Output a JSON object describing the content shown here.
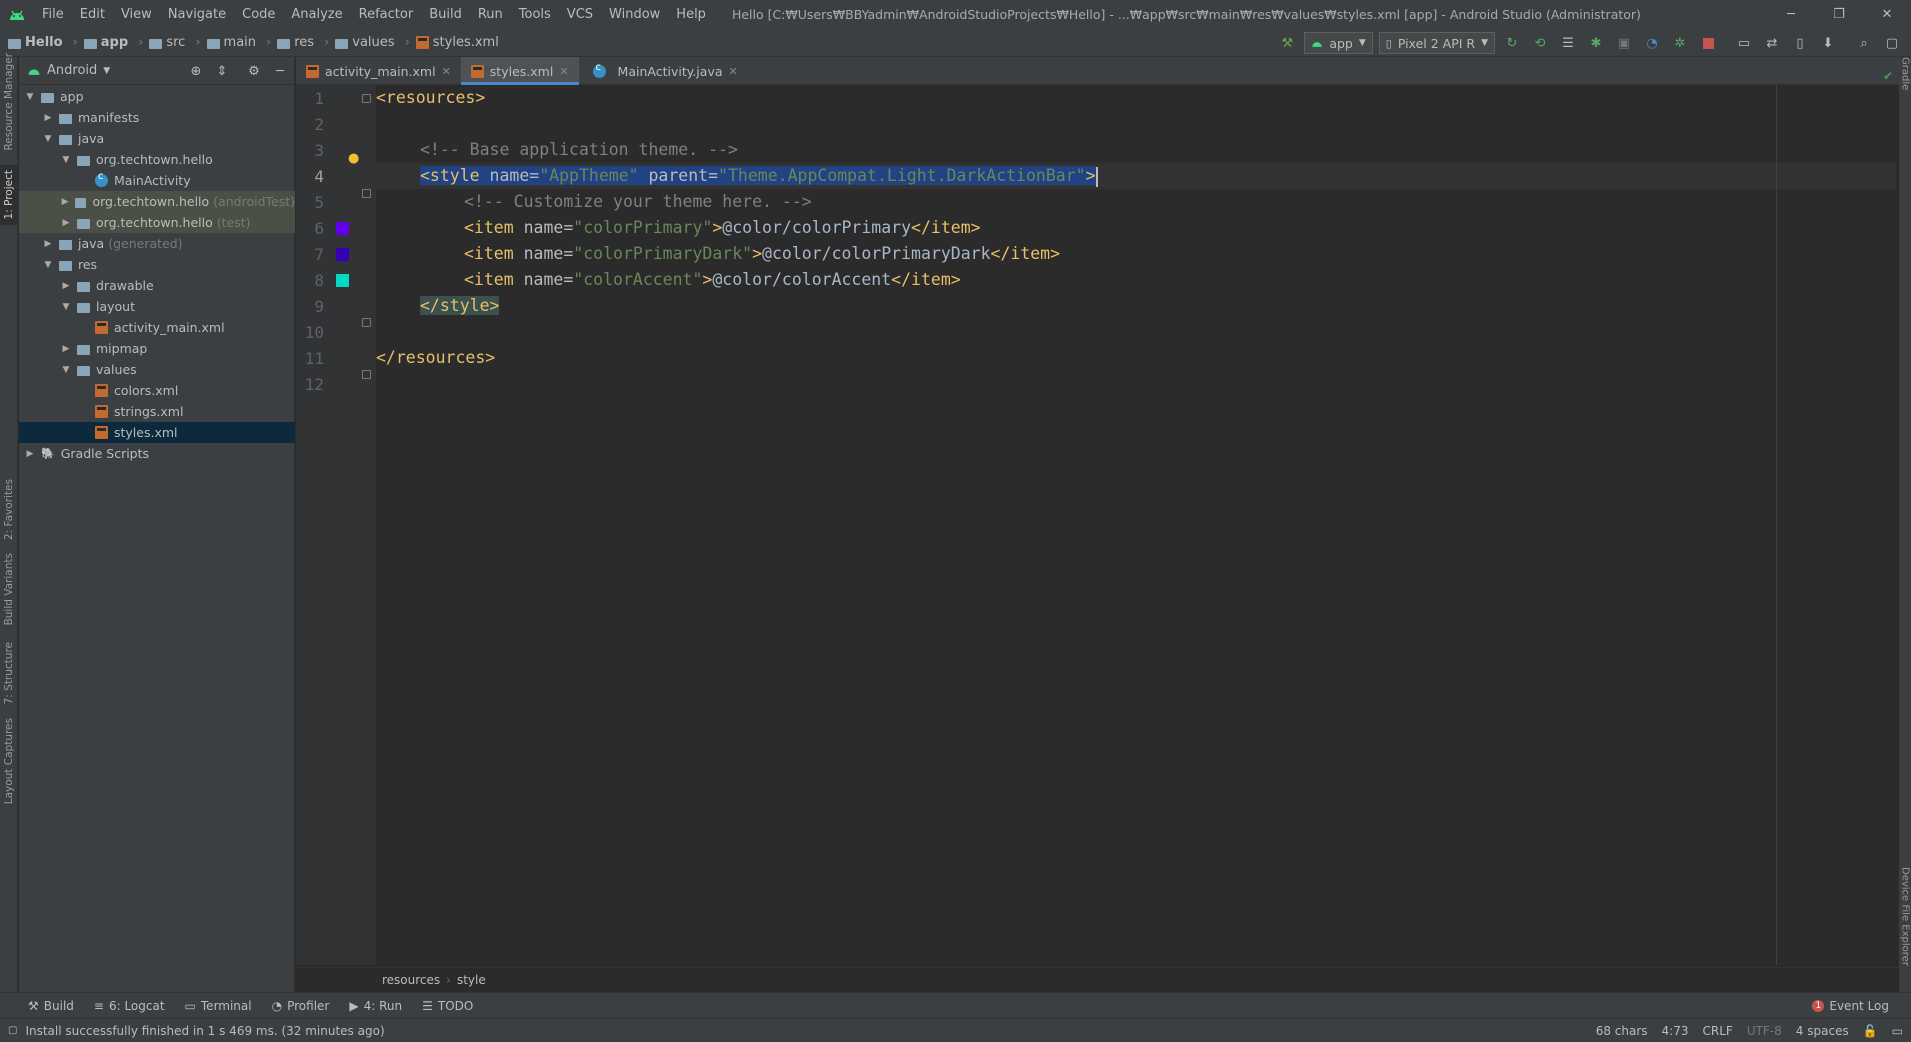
{
  "window": {
    "title": "Hello [C:₩Users₩BBYadmin₩AndroidStudioProjects₩Hello] - ...₩app₩src₩main₩res₩values₩styles.xml [app] - Android Studio (Administrator)",
    "menu": [
      "File",
      "Edit",
      "View",
      "Navigate",
      "Code",
      "Analyze",
      "Refactor",
      "Build",
      "Run",
      "Tools",
      "VCS",
      "Window",
      "Help"
    ],
    "minimize": "─",
    "restore": "❐",
    "close": "✕"
  },
  "breadcrumb": [
    "Hello",
    "app",
    "src",
    "main",
    "res",
    "values",
    "styles.xml"
  ],
  "toolbar": {
    "run_config": "app",
    "device": "Pixel 2 API R"
  },
  "left_strip": [
    "Resource Manager",
    "1: Project",
    "2: Favorites",
    "Build Variants",
    "7: Structure",
    "Layout Captures"
  ],
  "right_strip": [
    "Gradle",
    "Device File Explorer"
  ],
  "project": {
    "view_mode": "Android",
    "tree": [
      {
        "label": "app",
        "suffix": "",
        "depth": 0,
        "arrow": "▼",
        "icon": "folder"
      },
      {
        "label": "manifests",
        "suffix": "",
        "depth": 1,
        "arrow": "▶",
        "icon": "folder"
      },
      {
        "label": "java",
        "suffix": "",
        "depth": 1,
        "arrow": "▼",
        "icon": "folder"
      },
      {
        "label": "org.techtown.hello",
        "suffix": "",
        "depth": 2,
        "arrow": "▼",
        "icon": "folder"
      },
      {
        "label": "MainActivity",
        "suffix": "",
        "depth": 3,
        "arrow": "",
        "icon": "class"
      },
      {
        "label": "org.techtown.hello",
        "suffix": "(androidTest)",
        "depth": 2,
        "arrow": "▶",
        "icon": "folder"
      },
      {
        "label": "org.techtown.hello",
        "suffix": "(test)",
        "depth": 2,
        "arrow": "▶",
        "icon": "folder"
      },
      {
        "label": "java",
        "suffix": "(generated)",
        "depth": 1,
        "arrow": "▶",
        "icon": "folder"
      },
      {
        "label": "res",
        "suffix": "",
        "depth": 1,
        "arrow": "▼",
        "icon": "folder"
      },
      {
        "label": "drawable",
        "suffix": "",
        "depth": 2,
        "arrow": "▶",
        "icon": "folder"
      },
      {
        "label": "layout",
        "suffix": "",
        "depth": 2,
        "arrow": "▼",
        "icon": "folder"
      },
      {
        "label": "activity_main.xml",
        "suffix": "",
        "depth": 3,
        "arrow": "",
        "icon": "xml"
      },
      {
        "label": "mipmap",
        "suffix": "",
        "depth": 2,
        "arrow": "▶",
        "icon": "folder"
      },
      {
        "label": "values",
        "suffix": "",
        "depth": 2,
        "arrow": "▼",
        "icon": "folder"
      },
      {
        "label": "colors.xml",
        "suffix": "",
        "depth": 3,
        "arrow": "",
        "icon": "xml"
      },
      {
        "label": "strings.xml",
        "suffix": "",
        "depth": 3,
        "arrow": "",
        "icon": "xml"
      },
      {
        "label": "styles.xml",
        "suffix": "",
        "depth": 3,
        "arrow": "",
        "icon": "xml"
      },
      {
        "label": "Gradle Scripts",
        "suffix": "",
        "depth": 0,
        "arrow": "▶",
        "icon": "gradle"
      }
    ]
  },
  "tabs": [
    "activity_main.xml",
    "styles.xml",
    "MainActivity.java"
  ],
  "code": {
    "line_numbers": [
      "1",
      "2",
      "3",
      "4",
      "5",
      "6",
      "7",
      "8",
      "9",
      "10",
      "11",
      "12"
    ],
    "colors": {
      "colorPrimary": "#6200EE",
      "colorPrimaryDark": "#3700B3",
      "colorAccent": "#03DAC5"
    },
    "l1": {
      "open": "<resources>"
    },
    "l3": {
      "comment": "<!-- Base application theme. -->"
    },
    "l4": {
      "t1": "<style ",
      "a1": "name=",
      "v1": "\"AppTheme\"",
      "a2": " parent=",
      "v2": "\"Theme.AppCompat.Light.DarkActionBar\"",
      "t2": ">"
    },
    "l5": {
      "comment": "<!-- Customize your theme here. -->"
    },
    "l6": {
      "t1": "<item ",
      "a1": "name=",
      "v1": "\"colorPrimary\"",
      "t2": ">",
      "txt": "@color/colorPrimary",
      "t3": "</item>"
    },
    "l7": {
      "t1": "<item ",
      "a1": "name=",
      "v1": "\"colorPrimaryDark\"",
      "t2": ">",
      "txt": "@color/colorPrimaryDark",
      "t3": "</item>"
    },
    "l8": {
      "t1": "<item ",
      "a1": "name=",
      "v1": "\"colorAccent\"",
      "t2": ">",
      "txt": "@color/colorAccent",
      "t3": "</item>"
    },
    "l9": {
      "close": "</style>"
    },
    "l11": {
      "close": "</resources>"
    }
  },
  "editor_breadcrumb": [
    "resources",
    "style"
  ],
  "bottom_tabs": [
    "Build",
    "6: Logcat",
    "Terminal",
    "Profiler",
    "4: Run",
    "TODO"
  ],
  "event_log": {
    "badge": "1",
    "label": "Event Log"
  },
  "status": {
    "message": "Install successfully finished in 1 s 469 ms. (32 minutes ago)",
    "chars": "68 chars",
    "position": "4:73",
    "line_sep": "CRLF",
    "encoding": "UTF-8",
    "indent": "4 spaces"
  }
}
